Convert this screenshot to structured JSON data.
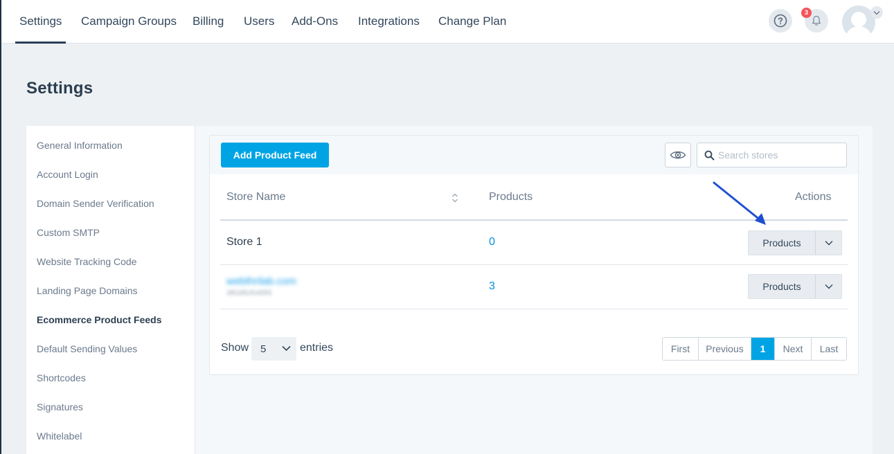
{
  "nav": {
    "tabs": [
      {
        "label": "Settings",
        "active": true
      },
      {
        "label": "Campaign Groups"
      },
      {
        "label": "Billing"
      },
      {
        "label": "Users"
      },
      {
        "label": "Add-Ons"
      },
      {
        "label": "Integrations"
      },
      {
        "label": "Change Plan"
      }
    ],
    "notification_count": "3"
  },
  "page": {
    "title": "Settings"
  },
  "sidebar": {
    "items": [
      {
        "label": "General Information"
      },
      {
        "label": "Account Login"
      },
      {
        "label": "Domain Sender Verification"
      },
      {
        "label": "Custom SMTP"
      },
      {
        "label": "Website Tracking Code"
      },
      {
        "label": "Landing Page Domains"
      },
      {
        "label": "Ecommerce Product Feeds",
        "active": true
      },
      {
        "label": "Default Sending Values"
      },
      {
        "label": "Shortcodes"
      },
      {
        "label": "Signatures"
      },
      {
        "label": "Whitelabel"
      }
    ]
  },
  "toolbar": {
    "add_button": "Add Product Feed",
    "search_placeholder": "Search stores"
  },
  "table": {
    "headers": {
      "store": "Store Name",
      "products": "Products",
      "actions": "Actions"
    },
    "rows": [
      {
        "store": "Store 1",
        "products": "0",
        "action": "Products"
      },
      {
        "store": "webthrilab.com",
        "store_sub": "181181414201",
        "products": "3",
        "action": "Products"
      }
    ]
  },
  "footer": {
    "show": "Show",
    "page_size": "5",
    "entries": "entries",
    "pager": {
      "first": "First",
      "previous": "Previous",
      "current": "1",
      "next": "Next",
      "last": "Last"
    }
  },
  "colors": {
    "accent": "#00a4e4",
    "annotation_arrow": "#1f4fd1",
    "badge": "#f2545b"
  },
  "icons": [
    "help-icon",
    "bell-icon",
    "avatar-icon",
    "chevron-down-icon",
    "eye-icon",
    "search-icon",
    "sort-icon",
    "arrow-annotation"
  ]
}
